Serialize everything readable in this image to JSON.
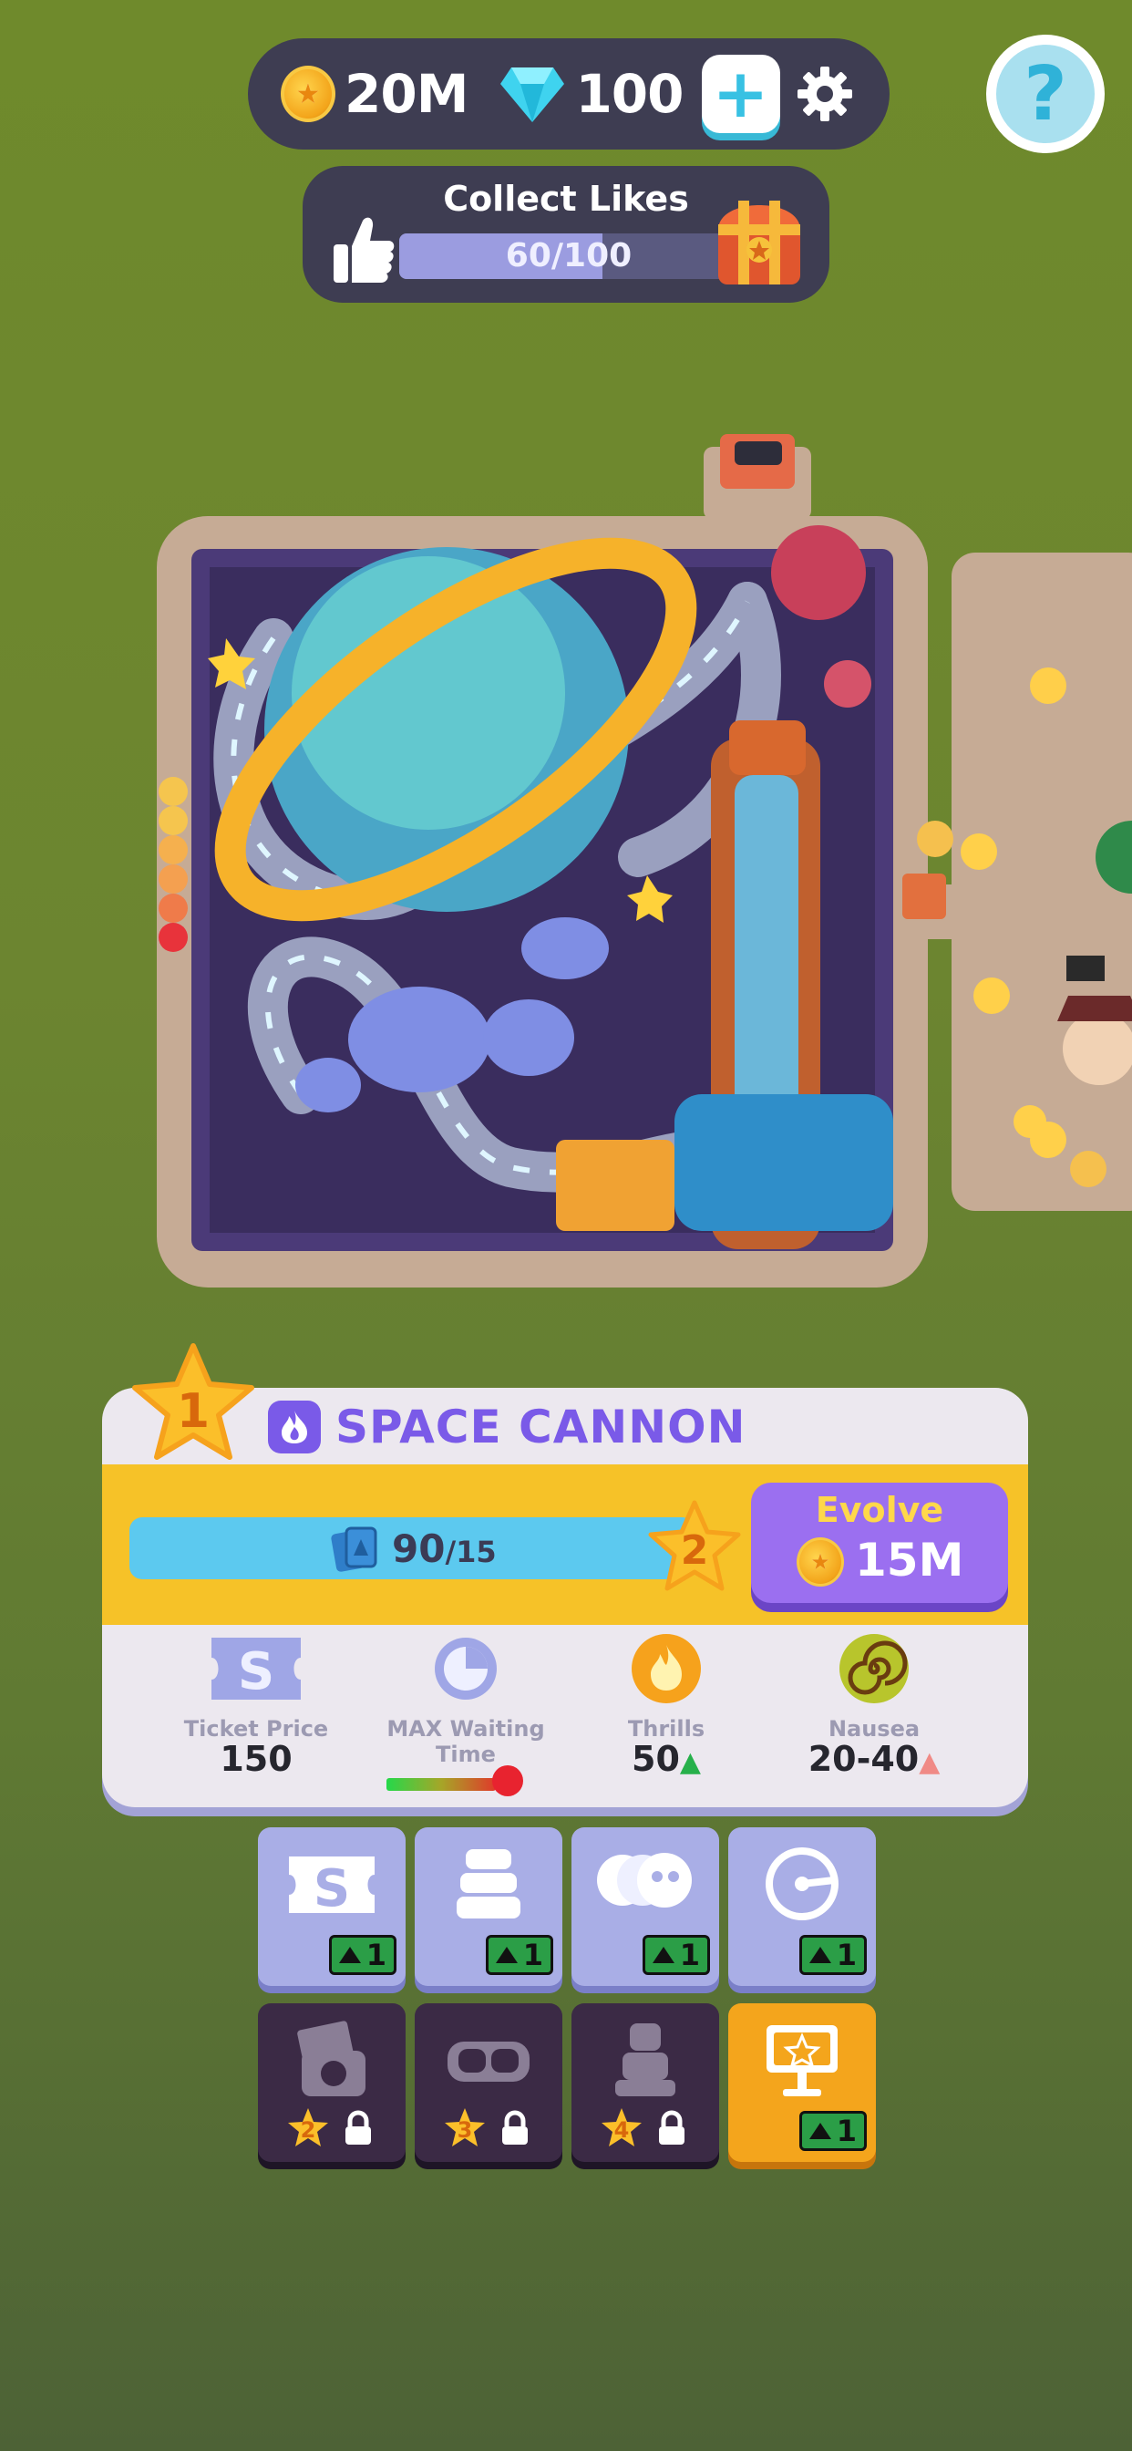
{
  "currency": {
    "coins": "20M",
    "gems": "100",
    "add_label": "+"
  },
  "help": {
    "label": "?"
  },
  "likes": {
    "title": "Collect Likes",
    "progress_text": "60/100",
    "progress": 0.6
  },
  "ride": {
    "level": "1",
    "name": "SPACE CANNON",
    "cards_have": "90",
    "cards_need": "/15",
    "next_level": "2",
    "evolve_label": "Evolve",
    "evolve_cost": "15M",
    "stats": [
      {
        "label": "Ticket Price",
        "value": "150"
      },
      {
        "label": "MAX Waiting Time",
        "value": ""
      },
      {
        "label": "Thrills",
        "value": "50"
      },
      {
        "label": "Nausea",
        "value": "20-40"
      }
    ]
  },
  "upgrades": [
    {
      "icon": "ticket-icon",
      "level": "1",
      "locked": false
    },
    {
      "icon": "seats-icon",
      "level": "1",
      "locked": false
    },
    {
      "icon": "capacity-icon",
      "level": "1",
      "locked": false
    },
    {
      "icon": "speed-gauge-icon",
      "level": "1",
      "locked": false
    },
    {
      "icon": "photo-camera-icon",
      "req": "2",
      "locked": true
    },
    {
      "icon": "vr-goggles-icon",
      "req": "3",
      "locked": true
    },
    {
      "icon": "seat-icon",
      "req": "4",
      "locked": true
    },
    {
      "icon": "billboard-icon",
      "level": "1",
      "locked": false,
      "highlight": true
    }
  ],
  "colors": {
    "panel_dark": "#3e3d52",
    "accent_purple": "#7a5ae8",
    "band_yellow": "#f6c228",
    "evolve_purple": "#9b6ff0",
    "xp_blue": "#5cc9ef",
    "upgrade_lavender": "#a9aee6",
    "locked_dark": "#3b2a45",
    "highlight_orange": "#f4a51c"
  }
}
